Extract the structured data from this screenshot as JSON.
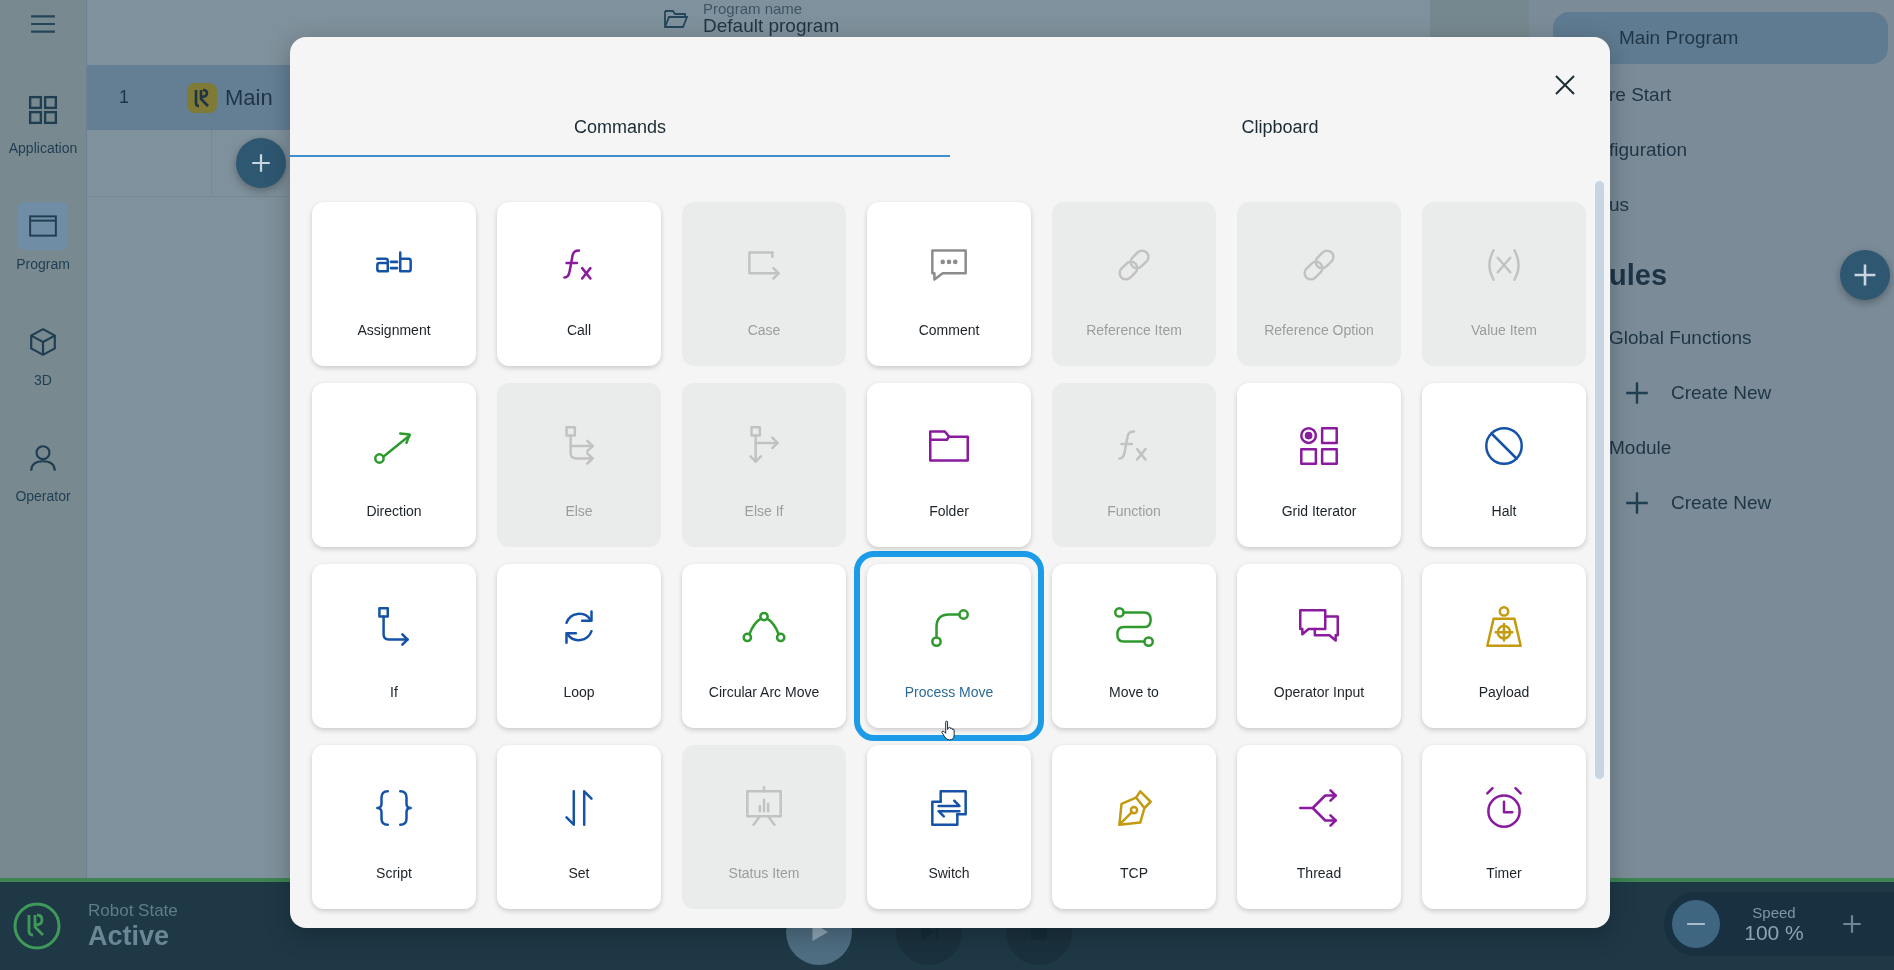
{
  "nav_rail": {
    "items": [
      {
        "label": "Application",
        "selected": false
      },
      {
        "label": "Program",
        "selected": true
      },
      {
        "label": "3D",
        "selected": false
      },
      {
        "label": "Operator",
        "selected": false
      }
    ]
  },
  "header": {
    "program_name_label": "Program name",
    "program_name": "Default program"
  },
  "program_tree": {
    "rows": [
      {
        "line": "1",
        "label": "Main",
        "selected": true
      }
    ]
  },
  "right_panel": {
    "items": [
      {
        "label": "Main Program",
        "selected": true
      },
      {
        "label": "re Start",
        "selected": false
      },
      {
        "label": "figuration",
        "selected": false
      },
      {
        "label": "us",
        "selected": false
      }
    ],
    "modules_heading": "ules",
    "groups": [
      {
        "label": "Global Functions",
        "action": "Create New"
      },
      {
        "label": "Module",
        "action": "Create New"
      }
    ]
  },
  "dialog": {
    "tabs": [
      {
        "label": "Commands",
        "selected": true
      },
      {
        "label": "Clipboard",
        "selected": false
      }
    ],
    "commands": [
      {
        "label": "Assignment",
        "disabled": false,
        "selected": false,
        "color": "#1552a8"
      },
      {
        "label": "Call",
        "disabled": false,
        "selected": false,
        "color": "#8a1a9e"
      },
      {
        "label": "Case",
        "disabled": true,
        "selected": false,
        "color": "#c2c2c2"
      },
      {
        "label": "Comment",
        "disabled": false,
        "selected": false,
        "color": "#8c8c8c"
      },
      {
        "label": "Reference Item",
        "disabled": true,
        "selected": false,
        "color": "#c2c2c2"
      },
      {
        "label": "Reference Option",
        "disabled": true,
        "selected": false,
        "color": "#c2c2c2"
      },
      {
        "label": "Value Item",
        "disabled": true,
        "selected": false,
        "color": "#c2c2c2"
      },
      {
        "label": "Direction",
        "disabled": false,
        "selected": false,
        "color": "#2e9a2e"
      },
      {
        "label": "Else",
        "disabled": true,
        "selected": false,
        "color": "#c2c2c2"
      },
      {
        "label": "Else If",
        "disabled": true,
        "selected": false,
        "color": "#c2c2c2"
      },
      {
        "label": "Folder",
        "disabled": false,
        "selected": false,
        "color": "#8a1a9e"
      },
      {
        "label": "Function",
        "disabled": true,
        "selected": false,
        "color": "#c2c2c2"
      },
      {
        "label": "Grid Iterator",
        "disabled": false,
        "selected": false,
        "color": "#8a1a9e"
      },
      {
        "label": "Halt",
        "disabled": false,
        "selected": false,
        "color": "#1552a8"
      },
      {
        "label": "If",
        "disabled": false,
        "selected": false,
        "color": "#1552a8"
      },
      {
        "label": "Loop",
        "disabled": false,
        "selected": false,
        "color": "#1552a8"
      },
      {
        "label": "Circular Arc Move",
        "disabled": false,
        "selected": false,
        "color": "#2e9a2e"
      },
      {
        "label": "Process Move",
        "disabled": false,
        "selected": true,
        "color": "#2e9a2e"
      },
      {
        "label": "Move to",
        "disabled": false,
        "selected": false,
        "color": "#2e9a2e"
      },
      {
        "label": "Operator Input",
        "disabled": false,
        "selected": false,
        "color": "#8a1a9e"
      },
      {
        "label": "Payload",
        "disabled": false,
        "selected": false,
        "color": "#c49a10"
      },
      {
        "label": "Script",
        "disabled": false,
        "selected": false,
        "color": "#1552a8"
      },
      {
        "label": "Set",
        "disabled": false,
        "selected": false,
        "color": "#1552a8"
      },
      {
        "label": "Status Item",
        "disabled": true,
        "selected": false,
        "color": "#c2c2c2"
      },
      {
        "label": "Switch",
        "disabled": false,
        "selected": false,
        "color": "#1552a8"
      },
      {
        "label": "TCP",
        "disabled": false,
        "selected": false,
        "color": "#c49a10"
      },
      {
        "label": "Thread",
        "disabled": false,
        "selected": false,
        "color": "#8a1a9e"
      },
      {
        "label": "Timer",
        "disabled": false,
        "selected": false,
        "color": "#8a1a9e"
      }
    ]
  },
  "status_bar": {
    "robot_state_label": "Robot State",
    "robot_state": "Active",
    "speed_label": "Speed",
    "speed": "100 %"
  }
}
